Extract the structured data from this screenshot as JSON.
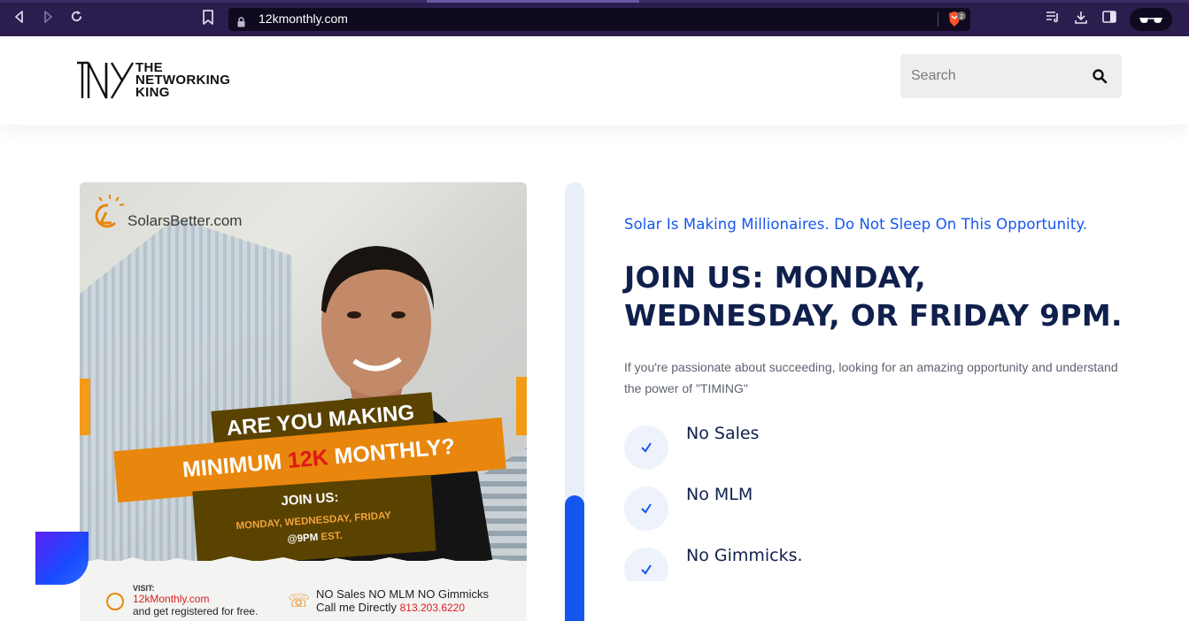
{
  "browser": {
    "url": "12kmonthly.com",
    "shield_count": "2"
  },
  "header": {
    "logo_text_line1": "THE",
    "logo_text_line2": "NETWORKING",
    "logo_text_line3": "KING",
    "search_placeholder": "Search"
  },
  "hero_image": {
    "brand": "SolarsBetter.com",
    "banner_line1": "ARE YOU MAKING",
    "banner_line2_a": "MINIMUM ",
    "banner_line2_hl": "12K",
    "banner_line2_b": " MONTHLY?",
    "join_label": "JOIN US:",
    "days_line1": "MONDAY, WEDNESDAY, FRIDAY",
    "days_time": "@9PM",
    "days_tz": " EST.",
    "visit_label": "VISIT:",
    "visit_url": "12kMonthly.com",
    "visit_sub": "and get registered for free.",
    "no_sales_line": "NO Sales NO MLM NO Gimmicks",
    "call_me": "Call me Directly ",
    "phone": "813.203.6220"
  },
  "progress": {
    "fraction": 0.287
  },
  "content": {
    "tagline": "Solar Is Making Millionaires. Do Not Sleep On This Opportunity.",
    "headline_line1": "JOIN US: MONDAY,",
    "headline_line2": "WEDNESDAY, OR FRIDAY 9PM.",
    "description": "If you're passionate about succeeding, looking for an amazing opportunity and understand the power of \"TIMING\"",
    "benefits": [
      {
        "label": "No Sales"
      },
      {
        "label": "No MLM"
      },
      {
        "label": "No Gimmicks."
      }
    ]
  },
  "colors": {
    "accent": "#1556f0",
    "heading": "#10204d",
    "orange": "#e8860d",
    "chrome_bg": "#2b1d4d"
  }
}
